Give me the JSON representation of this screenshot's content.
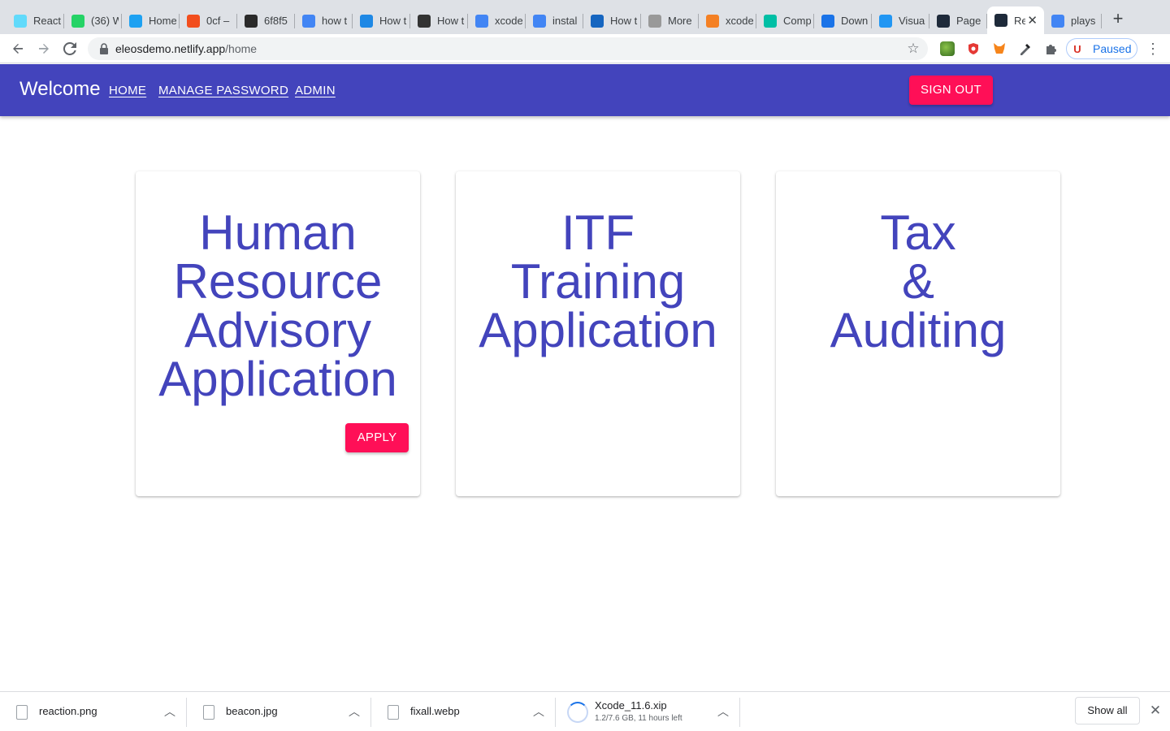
{
  "browser": {
    "tabs": [
      {
        "title": "React",
        "icon": "react-icon",
        "color": "#61dafb"
      },
      {
        "title": "(36) W",
        "icon": "whatsapp-icon",
        "color": "#25d366"
      },
      {
        "title": "Home",
        "icon": "twitter-icon",
        "color": "#1da1f2"
      },
      {
        "title": "0cf –",
        "icon": "figma-icon",
        "color": "#f24e1e"
      },
      {
        "title": "6f8f5",
        "icon": "vnc-icon",
        "color": "#2a2a2a"
      },
      {
        "title": "how t",
        "icon": "google-icon",
        "color": "#4285f4"
      },
      {
        "title": "How t",
        "icon": "pin-icon",
        "color": "#1e88e5"
      },
      {
        "title": "How t",
        "icon": "book-icon",
        "color": "#333333"
      },
      {
        "title": "xcode",
        "icon": "google-icon",
        "color": "#4285f4"
      },
      {
        "title": "instal",
        "icon": "google-icon",
        "color": "#4285f4"
      },
      {
        "title": "How t",
        "icon": "code-icon",
        "color": "#1565c0"
      },
      {
        "title": "More",
        "icon": "apple-icon",
        "color": "#999999"
      },
      {
        "title": "xcode",
        "icon": "stackoverflow-icon",
        "color": "#f48024"
      },
      {
        "title": "Comp",
        "icon": "mountain-icon",
        "color": "#00bfa5"
      },
      {
        "title": "Down",
        "icon": "download-icon",
        "color": "#1a73e8"
      },
      {
        "title": "Visua",
        "icon": "filter-icon",
        "color": "#2196f3"
      },
      {
        "title": "Page",
        "icon": "react-icon",
        "color": "#1e2a3a"
      },
      {
        "title": "Re",
        "icon": "react-icon",
        "color": "#1e2a3a",
        "active": true
      },
      {
        "title": "plays",
        "icon": "google-icon",
        "color": "#4285f4"
      }
    ],
    "new_tab_label": "+",
    "url_host": "eleosdemo.netlify.app",
    "url_path": "/home",
    "profile_label": "Paused",
    "profile_initial": "U"
  },
  "appbar": {
    "brand": "Welcome",
    "nav": [
      "HOME",
      "MANAGE PASSWORD",
      "ADMIN"
    ],
    "sign_out_label": "SIGN OUT",
    "accent_color": "#4344bc",
    "button_color": "#ff0f57"
  },
  "cards": [
    {
      "title_lines": [
        "Human",
        "Resource",
        "Advisory",
        "Application"
      ],
      "button_label": "APPLY"
    },
    {
      "title_lines": [
        "ITF",
        "Training",
        "Application"
      ]
    },
    {
      "title_lines": [
        "Tax",
        "&",
        "Auditing"
      ]
    }
  ],
  "downloads": {
    "items": [
      {
        "name": "reaction.png"
      },
      {
        "name": "beacon.jpg"
      },
      {
        "name": "fixall.webp"
      },
      {
        "name": "Xcode_11.6.xip",
        "status": "1.2/7.6 GB, 11 hours left"
      }
    ],
    "show_all_label": "Show all"
  }
}
